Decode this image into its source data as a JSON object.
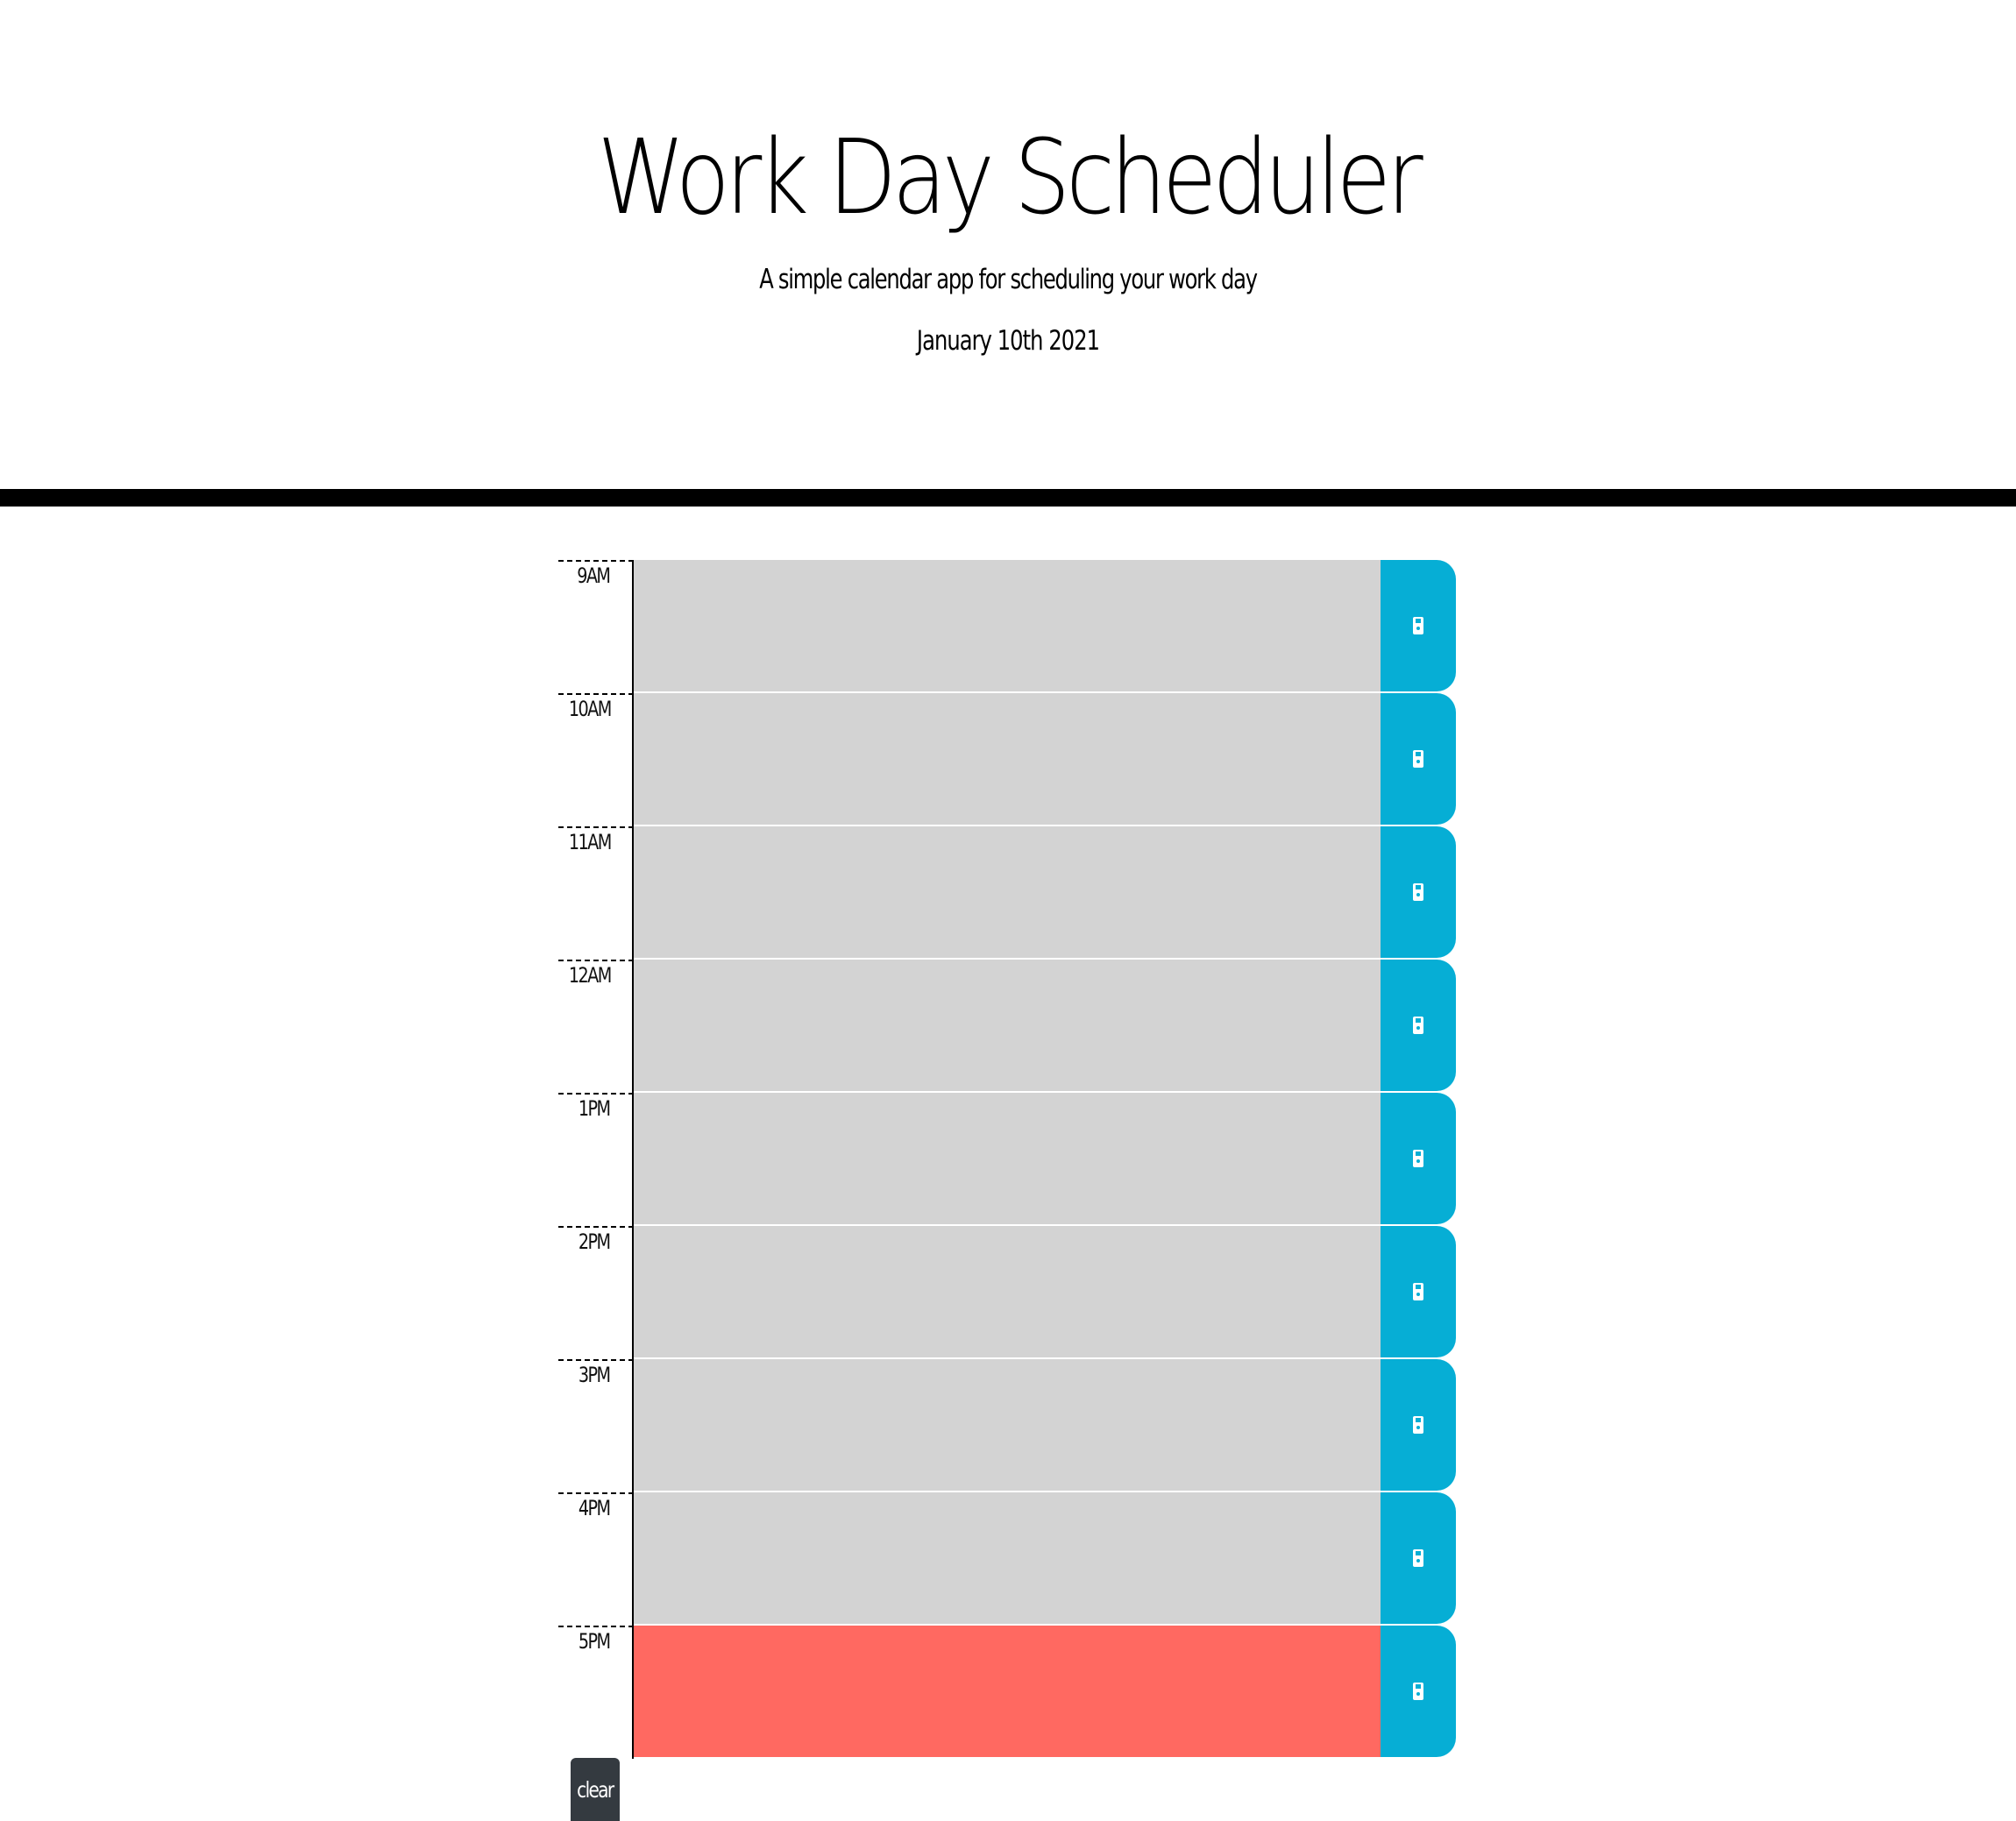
{
  "header": {
    "title": "Work Day Scheduler",
    "subtitle": "A simple calendar app for scheduling your work day",
    "current_date": "January 10th 2021"
  },
  "colors": {
    "past": "#d3d3d3",
    "present": "#ff6961",
    "future": "#77dd77",
    "save_button": "#06aed5",
    "clear_button": "#343a40"
  },
  "timeblocks": [
    {
      "hour": "9AM",
      "text": "",
      "status": "past",
      "save_icon": "save-icon"
    },
    {
      "hour": "10AM",
      "text": "",
      "status": "past",
      "save_icon": "save-icon"
    },
    {
      "hour": "11AM",
      "text": "",
      "status": "past",
      "save_icon": "save-icon"
    },
    {
      "hour": "12AM",
      "text": "",
      "status": "past",
      "save_icon": "save-icon"
    },
    {
      "hour": "1PM",
      "text": "",
      "status": "past",
      "save_icon": "save-icon"
    },
    {
      "hour": "2PM",
      "text": "",
      "status": "past",
      "save_icon": "save-icon"
    },
    {
      "hour": "3PM",
      "text": "",
      "status": "past",
      "save_icon": "save-icon"
    },
    {
      "hour": "4PM",
      "text": "",
      "status": "past",
      "save_icon": "save-icon"
    },
    {
      "hour": "5PM",
      "text": "",
      "status": "present",
      "save_icon": "save-icon"
    }
  ],
  "controls": {
    "clear_label": "clear"
  }
}
